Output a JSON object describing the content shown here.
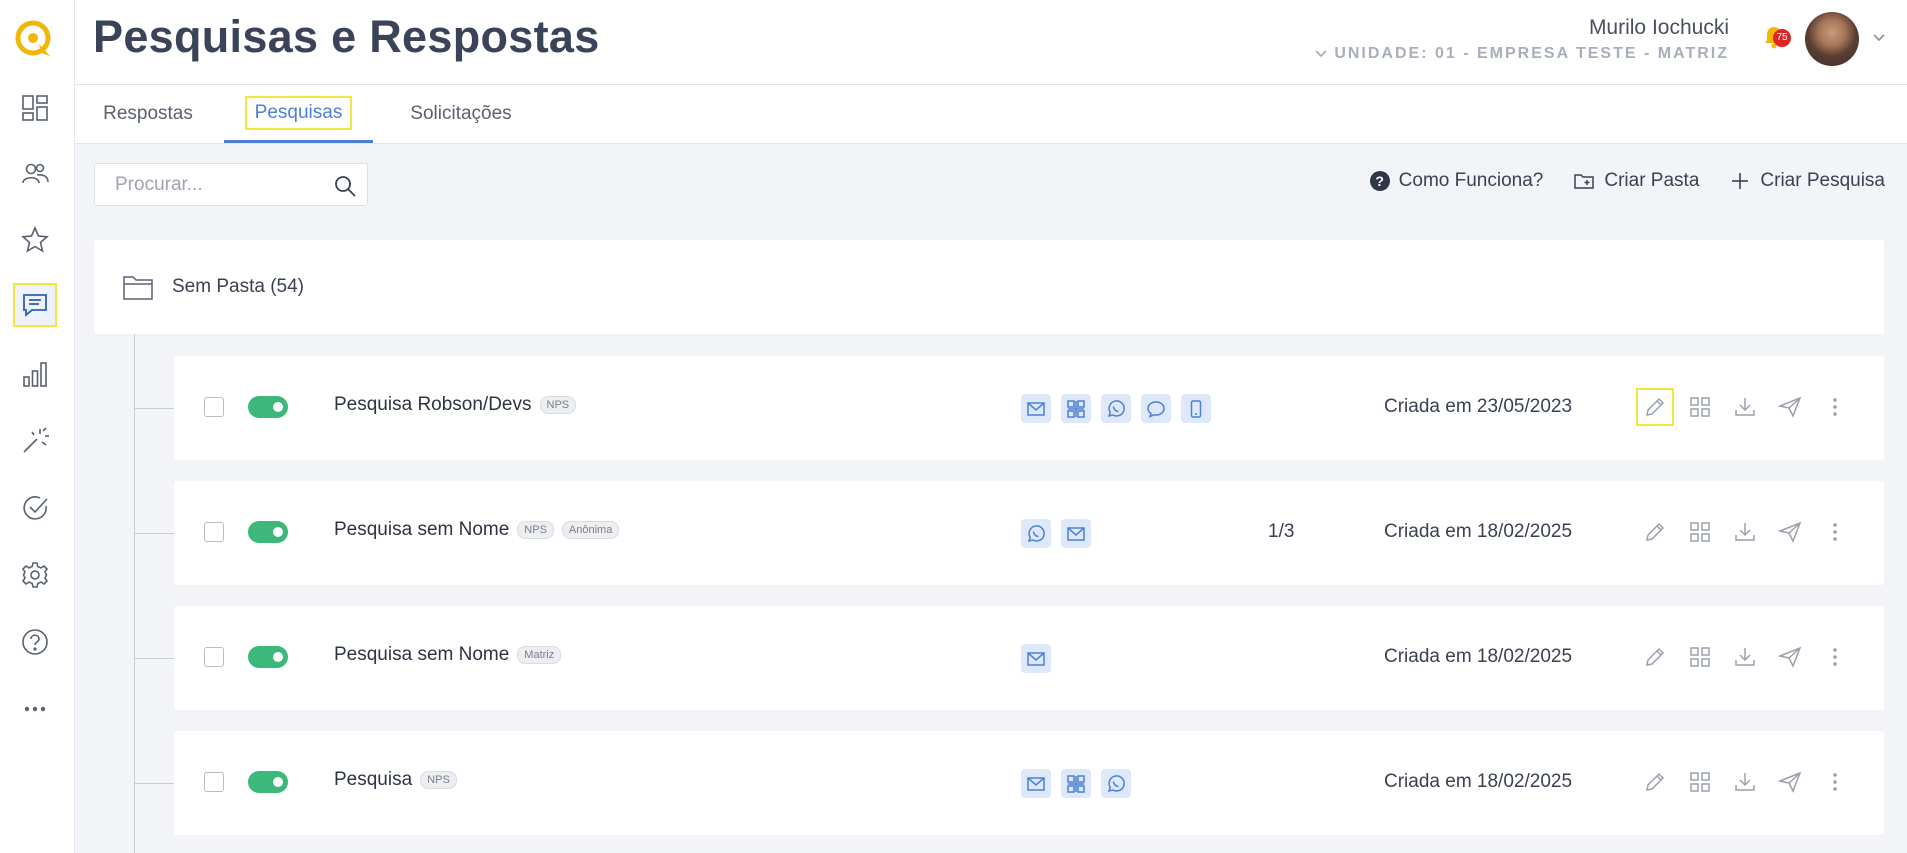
{
  "header": {
    "title": "Pesquisas e Respostas",
    "user_name": "Murilo Iochucki",
    "unit": "UNIDADE: 01 - EMPRESA TESTE - MATRIZ",
    "notifications": "75"
  },
  "sidebar": {
    "items": [
      {
        "icon": "dashboard-icon"
      },
      {
        "icon": "users-icon"
      },
      {
        "icon": "star-icon"
      },
      {
        "icon": "chat-icon",
        "active": true
      },
      {
        "icon": "bar-chart-icon"
      },
      {
        "icon": "magic-wand-icon"
      },
      {
        "icon": "check-circle-icon"
      },
      {
        "icon": "gear-icon"
      },
      {
        "icon": "help-icon"
      },
      {
        "icon": "more-icon"
      }
    ]
  },
  "tabs": [
    {
      "label": "Respostas"
    },
    {
      "label": "Pesquisas",
      "active": true
    },
    {
      "label": "Solicitações"
    }
  ],
  "search": {
    "placeholder": "Procurar..."
  },
  "actions": {
    "how_it_works": "Como Funciona?",
    "create_folder": "Criar Pasta",
    "create_survey": "Criar Pesquisa"
  },
  "folder": {
    "label": "Sem Pasta (54)"
  },
  "surveys": [
    {
      "name": "Pesquisa Robson/Devs",
      "tags": [
        "NPS"
      ],
      "channels": [
        "email",
        "qrcode",
        "whatsapp",
        "chat",
        "mobile"
      ],
      "count": "",
      "created": "Criada em 23/05/2023",
      "enabled": true
    },
    {
      "name": "Pesquisa sem Nome",
      "tags": [
        "NPS",
        "Anônima"
      ],
      "channels": [
        "whatsapp",
        "email"
      ],
      "count": "1/3",
      "created": "Criada em 18/02/2025",
      "enabled": true
    },
    {
      "name": "Pesquisa sem Nome",
      "tags": [
        "Matriz"
      ],
      "channels": [
        "email"
      ],
      "count": "",
      "created": "Criada em 18/02/2025",
      "enabled": true
    },
    {
      "name": "Pesquisa",
      "tags": [
        "NPS"
      ],
      "channels": [
        "email",
        "qrcode",
        "whatsapp"
      ],
      "count": "",
      "created": "Criada em 18/02/2025",
      "enabled": true
    }
  ],
  "colors": {
    "accent": "#4d7fd6",
    "toggle_on": "#3cb87a",
    "highlight": "#f2e640",
    "badge": "#e02424"
  }
}
